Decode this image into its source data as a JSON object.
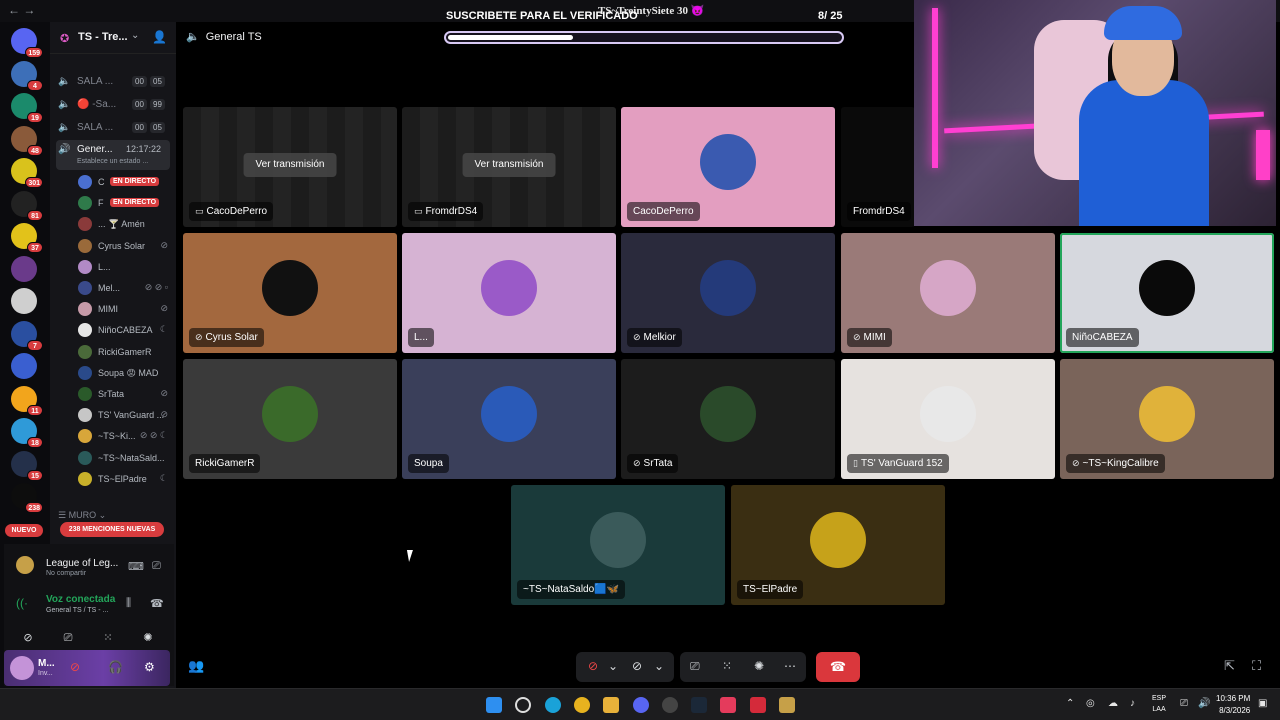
{
  "titlebar": {
    "nav": "←  →",
    "title": "TS~TreintySiete 30 😈"
  },
  "rail": {
    "servers": [
      {
        "badge": "159",
        "color": "#5865f2"
      },
      {
        "badge": "4",
        "color": "#3d6fb8"
      },
      {
        "badge": "19",
        "color": "#1b8a6b"
      },
      {
        "badge": "48",
        "color": "#8a5a3a"
      },
      {
        "badge": "301",
        "color": "#d9c21c"
      },
      {
        "badge": "81",
        "color": "#222"
      },
      {
        "badge": "37",
        "color": "#e2c21a"
      },
      {
        "badge": "",
        "color": "#6a3a8a"
      },
      {
        "badge": "",
        "color": "#cfcfcf"
      },
      {
        "badge": "7",
        "color": "#2a4fa0"
      },
      {
        "badge": "",
        "color": "#3a5fd0"
      },
      {
        "badge": "11",
        "color": "#f2a51c"
      },
      {
        "badge": "18",
        "color": "#2f9ad8"
      },
      {
        "badge": "15",
        "color": "#24304a"
      },
      {
        "badge": "238",
        "color": "#0d0d0d"
      }
    ],
    "nuevo": "NUEVO"
  },
  "sidebar": {
    "guild_name": "TS - Tre...",
    "channels": [
      {
        "name": "SALA ...",
        "c1": "00",
        "c2": "05"
      },
      {
        "name": "🔴 -Sa...",
        "c1": "00",
        "c2": "99"
      },
      {
        "name": "SALA ...",
        "c1": "00",
        "c2": "05"
      }
    ],
    "selected": {
      "name": "Gener...",
      "time": "12:17:22",
      "sub": "Establece un estado ..."
    },
    "users": [
      {
        "name": "C",
        "tag": "EN DIRECTO",
        "right": "",
        "color": "#4a6fd0"
      },
      {
        "name": "F",
        "tag": "EN DIRECTO",
        "right": "",
        "color": "#2f7a4a"
      },
      {
        "name": "... 🍸 Amén",
        "tag": "",
        "right": "",
        "color": "#8a3a3a"
      },
      {
        "name": "Cyrus Solar",
        "tag": "",
        "right": "⊘",
        "color": "#9a6a3a"
      },
      {
        "name": "L...",
        "tag": "",
        "right": "",
        "color": "#b28ac6"
      },
      {
        "name": "Mel...",
        "tag": "",
        "right": "⊘ ⊘ ▫",
        "color": "#3a4a8a"
      },
      {
        "name": "MIMI",
        "tag": "",
        "right": "⊘",
        "color": "#c69aa8"
      },
      {
        "name": "NiñoCABEZA",
        "tag": "",
        "right": "☾",
        "color": "#e6e6e6"
      },
      {
        "name": "RickiGamerR",
        "tag": "",
        "right": "",
        "color": "#4a6a3a"
      },
      {
        "name": "Soupa 😡 MAD",
        "tag": "",
        "right": "",
        "color": "#2a4a8a"
      },
      {
        "name": "SrTata",
        "tag": "",
        "right": "⊘",
        "color": "#2a5a2a"
      },
      {
        "name": "TS' VanGuard ...",
        "tag": "",
        "right": "⊘",
        "color": "#c6c6c6"
      },
      {
        "name": "~TS~Ki...",
        "tag": "",
        "right": "⊘ ⊘ ☾",
        "color": "#d8a63a"
      },
      {
        "name": "~TS~NataSald...",
        "tag": "",
        "right": "",
        "color": "#2a5a5a"
      },
      {
        "name": "TS~ElPadre",
        "tag": "",
        "right": "☾",
        "color": "#c8b02a"
      }
    ],
    "muro": "☰ MURO ⌄",
    "mentions": "238 MENCIONES NUEVAS",
    "activity": {
      "name": "League of Leg...",
      "status": "No compartir"
    },
    "voice": {
      "title": "Voz conectada",
      "sub": "General TS / TS - ..."
    },
    "me": {
      "name": "M...",
      "status": "Inv..."
    }
  },
  "stage": {
    "channel": "General TS",
    "banner": "SUSCRIBETE PARA EL VERIFICADO",
    "progress": {
      "count": "8/ 25",
      "fraction": 0.32
    },
    "watch_label": "Ver transmisión",
    "tiles": [
      {
        "label": "CacoDePerro",
        "icon": "▭",
        "type": "stream",
        "bg": "#1a1a1a"
      },
      {
        "label": "FromdrDS4",
        "icon": "▭",
        "type": "stream",
        "bg": "#1a1a1a"
      },
      {
        "label": "CacoDePerro",
        "icon": "",
        "type": "avatar",
        "bg": "#e39ec0",
        "pic": "#3a5ab0"
      },
      {
        "label": "FromdrDS4",
        "icon": "",
        "type": "plain",
        "bg": "#0a0a0a"
      },
      {
        "label": "Cyrus Solar",
        "icon": "⊘",
        "type": "avatar",
        "bg": "#a3683e",
        "pic": "#111"
      },
      {
        "label": "L...",
        "icon": "",
        "type": "avatar",
        "bg": "#d6b3d3",
        "pic": "#9a5ac8"
      },
      {
        "label": "Melkior",
        "icon": "⊘",
        "type": "avatar",
        "bg": "#2a2a3c",
        "pic": "#243a7a"
      },
      {
        "label": "MIMI",
        "icon": "⊘",
        "type": "avatar",
        "bg": "#9a7a78",
        "pic": "#d6a6c6"
      },
      {
        "label": "NiñoCABEZA",
        "icon": "",
        "type": "avatar",
        "bg": "#d6d8de",
        "pic": "#0a0a0a"
      },
      {
        "label": "RickiGamerR",
        "icon": "",
        "type": "avatar",
        "bg": "#3a3a3a",
        "pic": "#3a6a2a"
      },
      {
        "label": "Soupa",
        "icon": "",
        "type": "avatar",
        "bg": "#3a3f5a",
        "pic": "#2a5ab8"
      },
      {
        "label": "SrTata",
        "icon": "⊘",
        "type": "avatar",
        "bg": "#1c1c1c",
        "pic": "#2a4a2a"
      },
      {
        "label": "TS' VanGuard 152",
        "icon": "▯",
        "type": "avatar",
        "bg": "#e6e2df",
        "pic": "#e8e8e8"
      },
      {
        "label": "~TS~KingCalibre",
        "icon": "⊘",
        "type": "avatar",
        "bg": "#7a645a",
        "pic": "#e0b23a"
      },
      {
        "label": "~TS~NataSaldo🟦🦋",
        "icon": "",
        "type": "avatar",
        "bg": "#1a3a3a",
        "pic": "#3a5a5a"
      },
      {
        "label": "TS~ElPadre",
        "icon": "",
        "type": "avatar",
        "bg": "#3a2e12",
        "pic": "#c6a21a"
      }
    ]
  },
  "controls": {
    "mic": "⊘",
    "caret": "⌄",
    "camera": "⊘",
    "share": "⎚",
    "activities": "⁙",
    "soundboard": "✺",
    "more": "⋯",
    "hangup": "☎",
    "popout": "⇱",
    "fullscreen": "⛶"
  },
  "taskbar": {
    "lang1": "ESP",
    "lang2": "LAA",
    "time": "10:36 PM",
    "date": "8/3/2026"
  }
}
